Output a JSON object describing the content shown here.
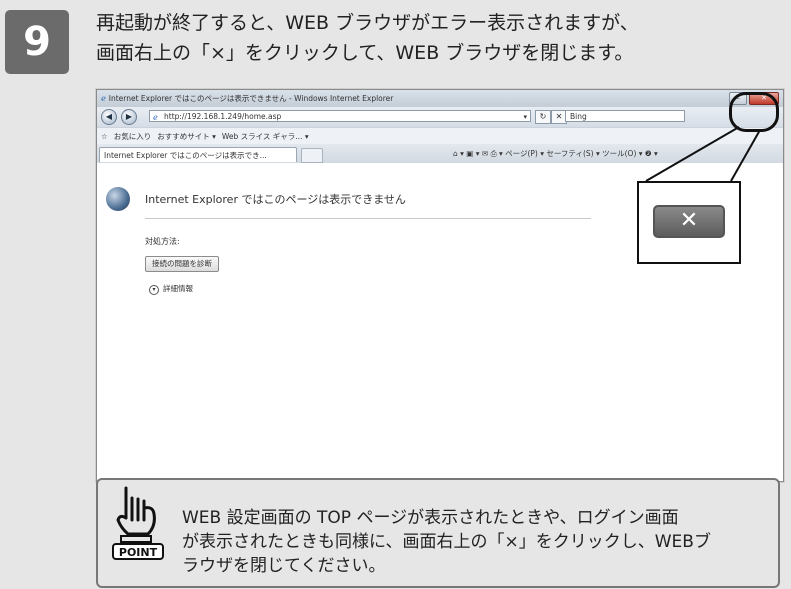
{
  "step": {
    "number": "9",
    "line1": "再起動が終了すると、WEB ブラウザがエラー表示されますが、",
    "line2": "画面右上の「×」をクリックして、WEB ブラウザを閉じます。"
  },
  "browser": {
    "window_title": "Internet Explorer ではこのページは表示できません - Windows Internet Explorer",
    "minimize": "–",
    "close": "✕",
    "url": "http://192.168.1.249/home.asp",
    "search_placeholder": "Bing",
    "favorites_label": "お気に入り",
    "suggested_sites": "おすすめサイト ▾",
    "web_slice": "Web スライス ギャラ... ▾",
    "tab_title": "Internet Explorer ではこのページは表示でき...",
    "toolbar_items": "⌂ ▾  ▣ ▾  ✉  ⎙ ▾  ページ(P) ▾  セーフティ(S) ▾  ツール(O) ▾  ❷ ▾",
    "error_title": "Internet Explorer ではこのページは表示できません",
    "remedy_label": "対処方法:",
    "diagnose_button": "接続の問題を診断",
    "details_label": "詳細情報"
  },
  "callout": {
    "close_symbol": "✕"
  },
  "point": {
    "badge": "POINT",
    "line1": "WEB 設定画面の TOP ページが表示されたときや、ログイン画面",
    "line2": "が表示されたときも同様に、画面右上の「×」をクリックし、WEBブ",
    "line3": "ラウザを閉じてください。"
  }
}
